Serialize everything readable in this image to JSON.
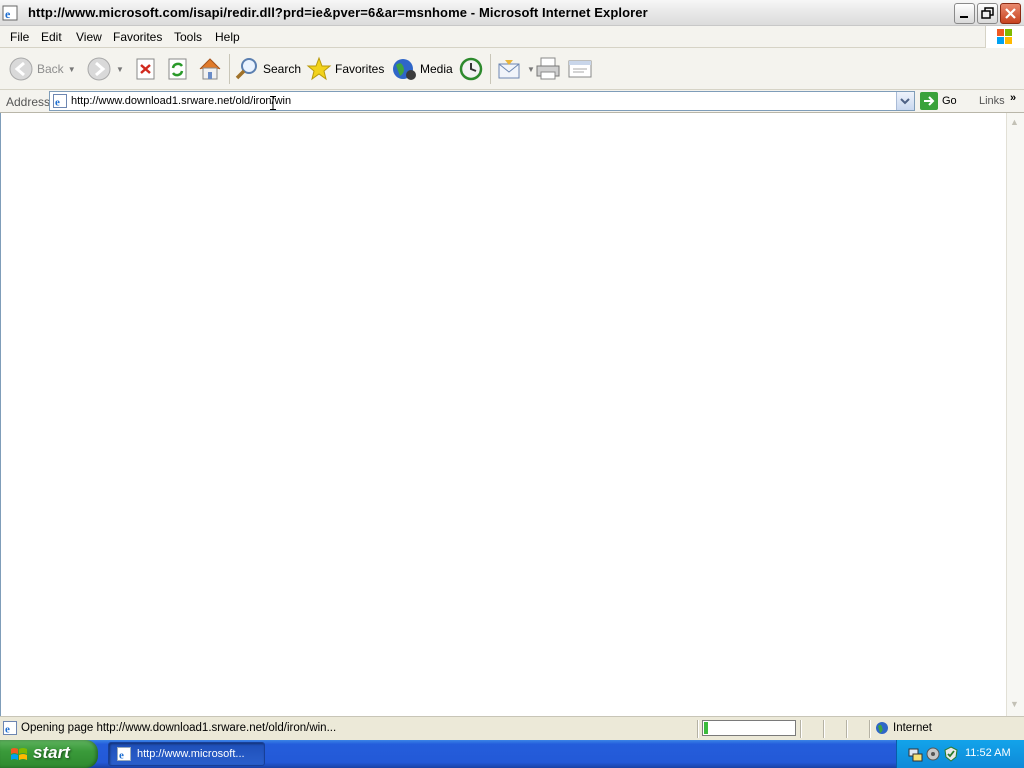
{
  "window": {
    "title": "http://www.microsoft.com/isapi/redir.dll?prd=ie&pver=6&ar=msnhome - Microsoft Internet Explorer"
  },
  "menu": {
    "items": [
      {
        "label": "File"
      },
      {
        "label": "Edit"
      },
      {
        "label": "View"
      },
      {
        "label": "Favorites"
      },
      {
        "label": "Tools"
      },
      {
        "label": "Help"
      }
    ]
  },
  "toolbar": {
    "back_label": "Back",
    "search_label": "Search",
    "favorites_label": "Favorites",
    "media_label": "Media"
  },
  "address": {
    "label": "Address",
    "url": "http://www.download1.srware.net/old/iron/win",
    "go_label": "Go",
    "links_label": "Links",
    "links_chevron": "»"
  },
  "status": {
    "text": "Opening page http://www.download1.srware.net/old/iron/win...",
    "progress_fraction": 0.06,
    "zone": "Internet"
  },
  "taskbar": {
    "start_label": "start",
    "task_label": "http://www.microsoft...",
    "clock": "11:52 AM"
  },
  "colors": {
    "taskbar_blue": "#245ddb",
    "start_green": "#3a9a3a",
    "close_red": "#c7421f",
    "progress_green": "#3cbb3c"
  }
}
